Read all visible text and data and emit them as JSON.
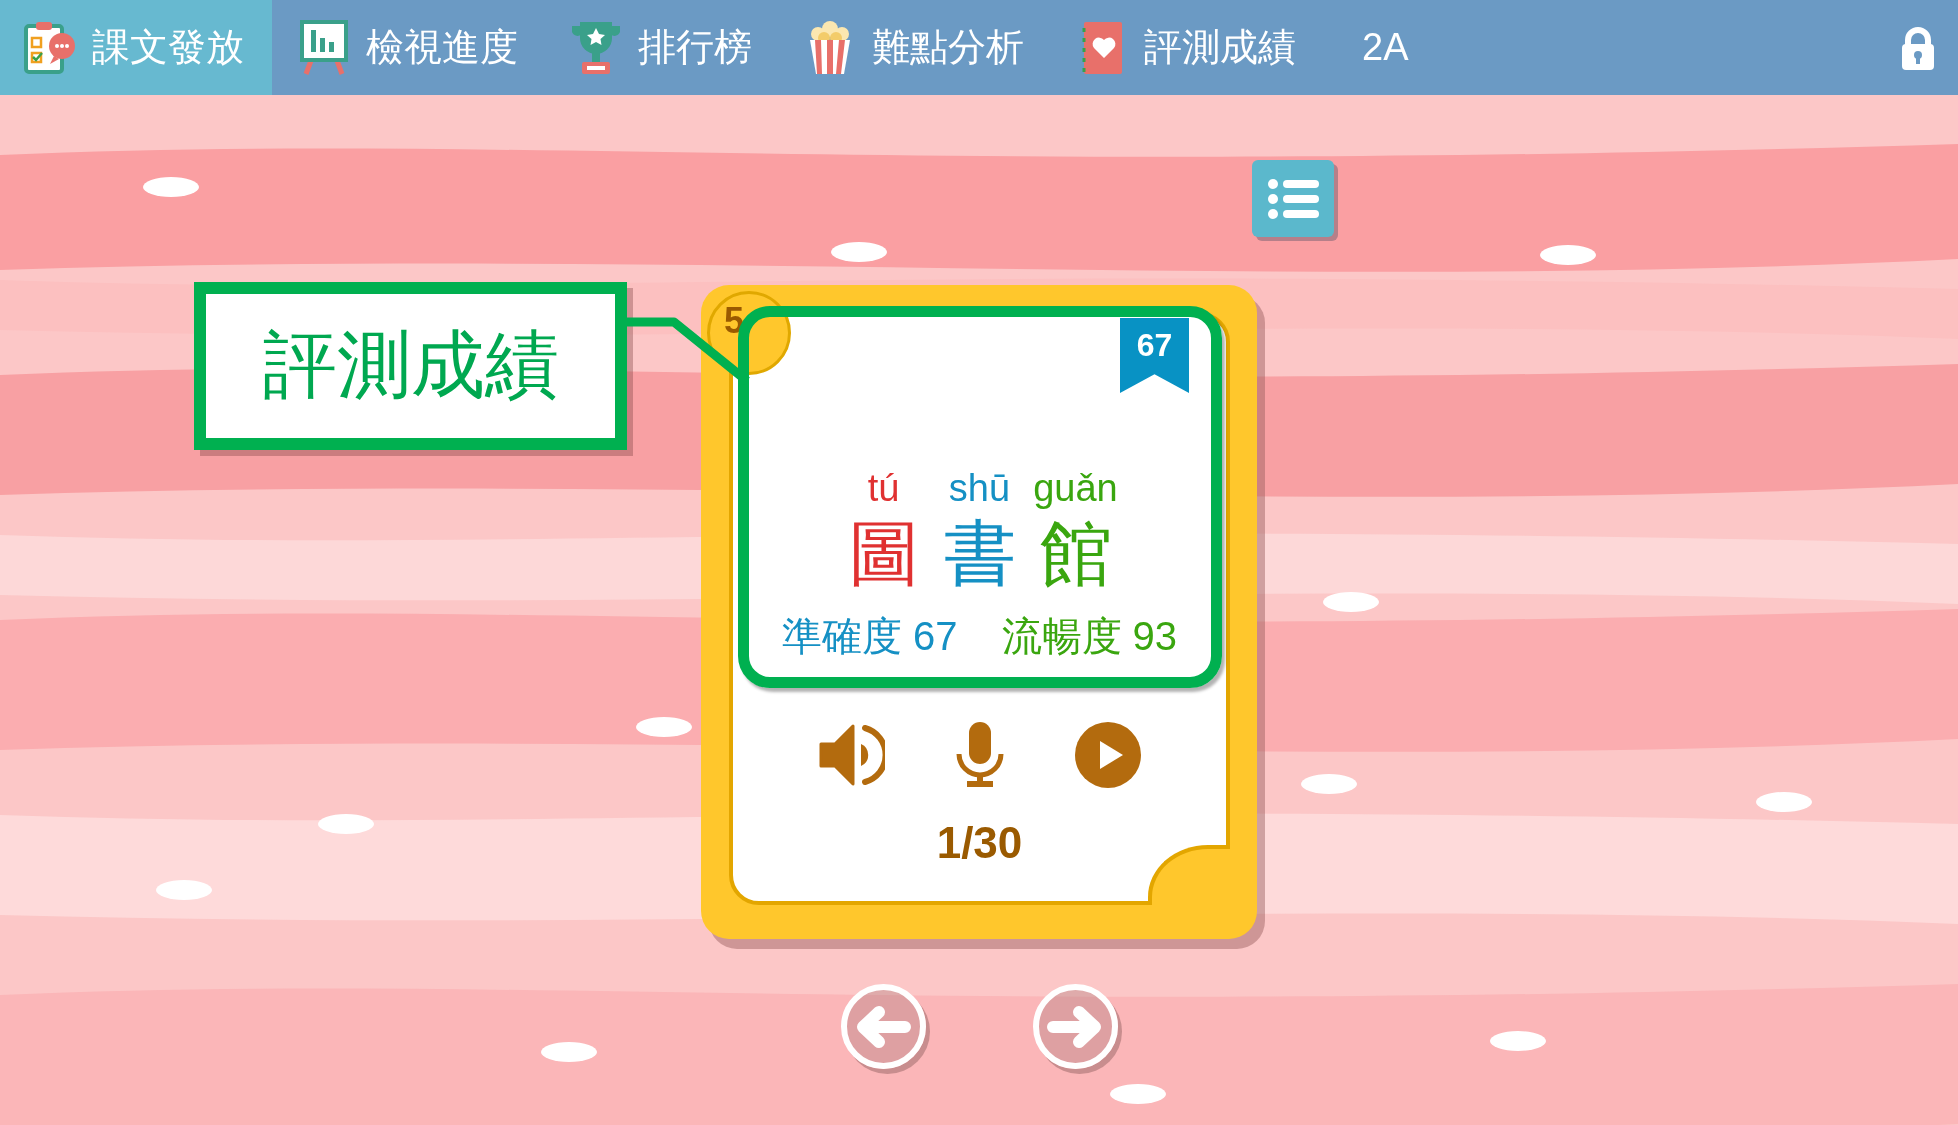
{
  "tabs": [
    {
      "label": "課文發放",
      "selected": true
    },
    {
      "label": "檢視進度",
      "selected": false
    },
    {
      "label": "排行榜",
      "selected": false
    },
    {
      "label": "難點分析",
      "selected": false
    },
    {
      "label": "評測成績",
      "selected": false
    }
  ],
  "class_label": "2A",
  "callout": {
    "text": "評測成績"
  },
  "card": {
    "number": "5",
    "ribbon": "67",
    "syllables": [
      {
        "pinyin": "tú",
        "character": "圖",
        "color": "#e03131"
      },
      {
        "pinyin": "shū",
        "character": "書",
        "color": "#1590c4"
      },
      {
        "pinyin": "guǎn",
        "character": "館",
        "color": "#3aa60f"
      }
    ],
    "scores": [
      {
        "text": "準確度 67",
        "color": "#1590c4"
      },
      {
        "text": "流暢度 93",
        "color": "#3aa60f"
      }
    ],
    "counter": "1/30"
  }
}
